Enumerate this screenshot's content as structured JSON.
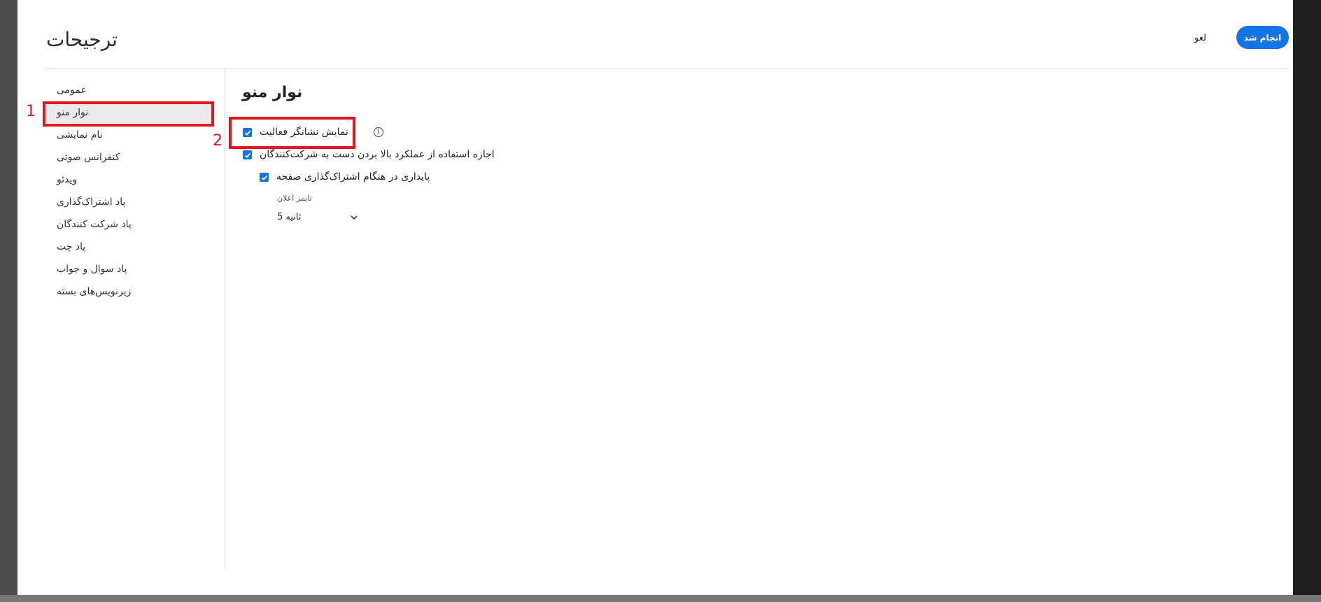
{
  "dialog": {
    "title": "ترجیحات",
    "cancel_label": "لغو",
    "done_label": "انجام شد"
  },
  "sidebar": {
    "items": [
      {
        "label": "عمومی"
      },
      {
        "label": "نوار منو",
        "selected": true
      },
      {
        "label": "نام نمایشی"
      },
      {
        "label": "کنفرانس صوتی"
      },
      {
        "label": "ویدئو"
      },
      {
        "label": "پاد اشتراک‌گذاری"
      },
      {
        "label": "پاد شرکت کنندگان"
      },
      {
        "label": "پاد چت"
      },
      {
        "label": "پاد سوال و جواب"
      },
      {
        "label": "زیرنویس‌های بسته"
      }
    ]
  },
  "section": {
    "title": "نوار منو",
    "options": [
      {
        "label": "نمایش نشانگر فعالیت",
        "checked": true
      },
      {
        "label": "اجازه استفاده از عملکرد بالا بردن دست به شرکت‌کنندگان",
        "checked": true
      },
      {
        "label": "پایداری در هنگام اشتراک‌گذاری صفحه",
        "checked": true
      }
    ],
    "timer_label": "تایمر اعلان",
    "timer_value": "ثانیه 5"
  },
  "annotations": [
    "1",
    "2"
  ],
  "colors": {
    "accent": "#1473e6",
    "annotation": "#e3161c",
    "selected_bg": "#eaeaea"
  },
  "icons": {
    "info": "info-icon",
    "dropdown": "chevron-down-icon",
    "check": "checkmark-icon"
  }
}
